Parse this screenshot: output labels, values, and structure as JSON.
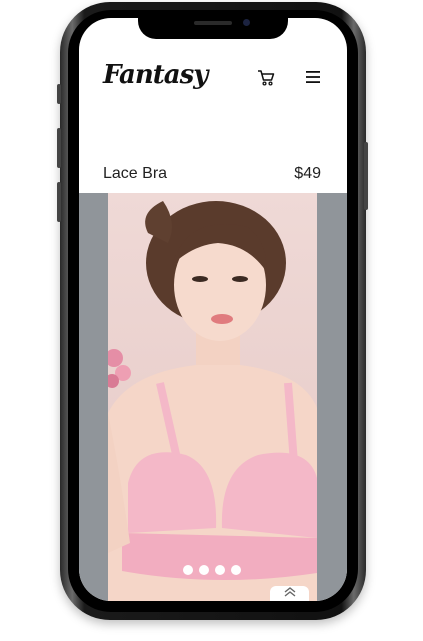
{
  "brand": {
    "name": "Fantasy"
  },
  "header": {
    "cart_icon": "cart-icon",
    "menu_icon": "menu-icon"
  },
  "product": {
    "name": "Lace Bra",
    "price": "$49"
  },
  "gallery": {
    "image_subject": "model in pink bra",
    "dot_count": 4,
    "active_dot": 1,
    "scroll_up_icon": "chevron-up-double-icon"
  },
  "colors": {
    "gallery_background": "#90959a",
    "phone_frame": "#111111",
    "bra_pink": "#f4b8c8"
  }
}
